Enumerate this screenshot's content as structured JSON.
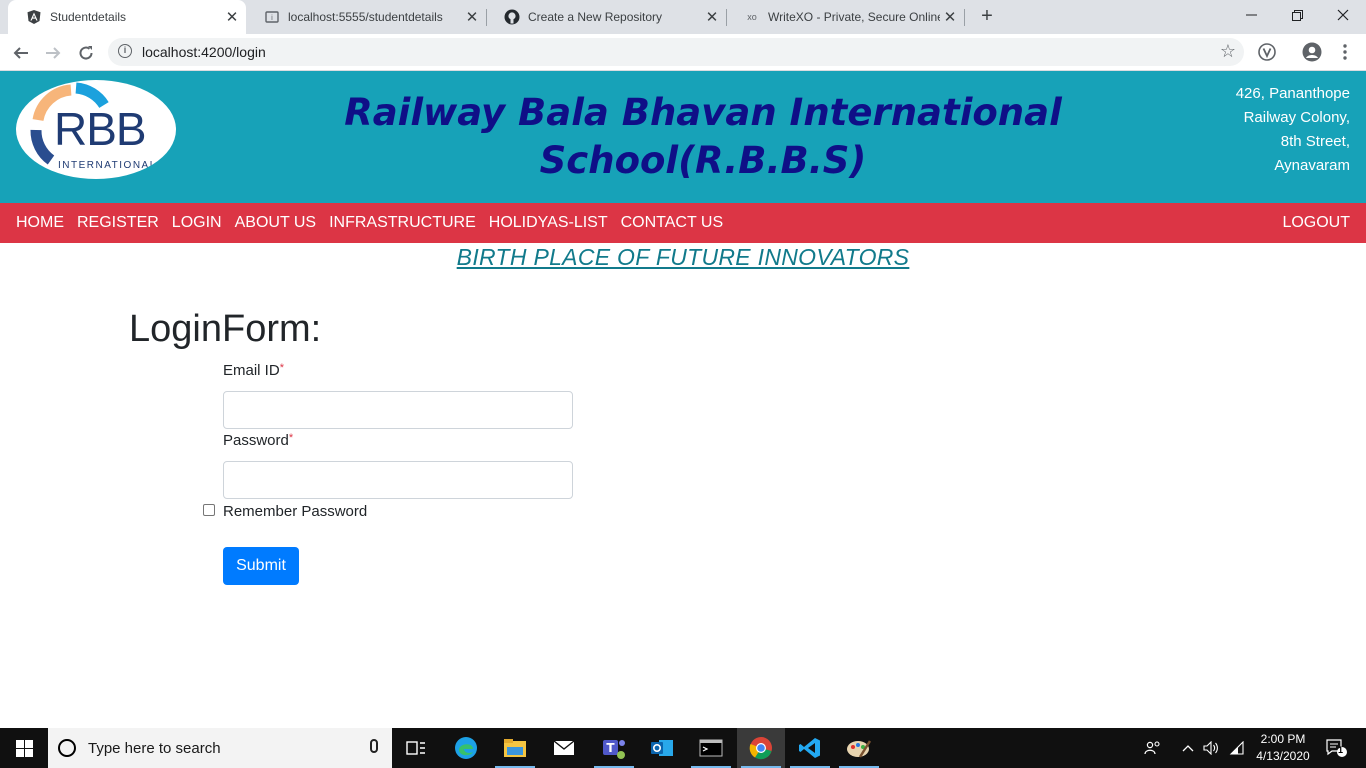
{
  "browser": {
    "tabs": [
      {
        "title": "Studentdetails",
        "icon": "angular-icon",
        "active": true
      },
      {
        "title": "localhost:5555/studentdetails",
        "icon": "page-icon",
        "active": false
      },
      {
        "title": "Create a New Repository",
        "icon": "github-icon",
        "active": false
      },
      {
        "title": "WriteXO - Private, Secure Online",
        "icon": "xo-icon",
        "active": false
      }
    ],
    "url": "localhost:4200/login"
  },
  "header": {
    "logo_text": "RBB",
    "logo_subtext": "INTERNATIONAL",
    "title_line1": "Railway Bala Bhavan International",
    "title_line2": "School(R.B.B.S)",
    "address": [
      "426, Pananthope",
      "Railway Colony,",
      "8th Street,",
      "Aynavaram"
    ]
  },
  "nav": {
    "items": [
      "HOME",
      "REGISTER",
      "LOGIN",
      "ABOUT US",
      "INFRASTRUCTURE",
      "HOLIDYAS-LIST",
      "CONTACT US"
    ],
    "logout": "LOGOUT"
  },
  "tagline": "BIRTH PLACE OF FUTURE INNOVATORS",
  "form": {
    "title": "LoginForm:",
    "email_label": "Email ID",
    "password_label": "Password",
    "required_mark": "*",
    "email_value": "",
    "password_value": "",
    "remember_label": "Remember Password",
    "remember_checked": false,
    "submit_label": "Submit"
  },
  "taskbar": {
    "search_placeholder": "Type here to search",
    "time": "2:00 PM",
    "date": "4/13/2020",
    "notification_count": "1"
  },
  "colors": {
    "header_bg": "#17a2b8",
    "nav_bg": "#dc3545",
    "title_color": "#0f0f87",
    "tagline_color": "#117a8b",
    "submit_bg": "#007bff"
  }
}
